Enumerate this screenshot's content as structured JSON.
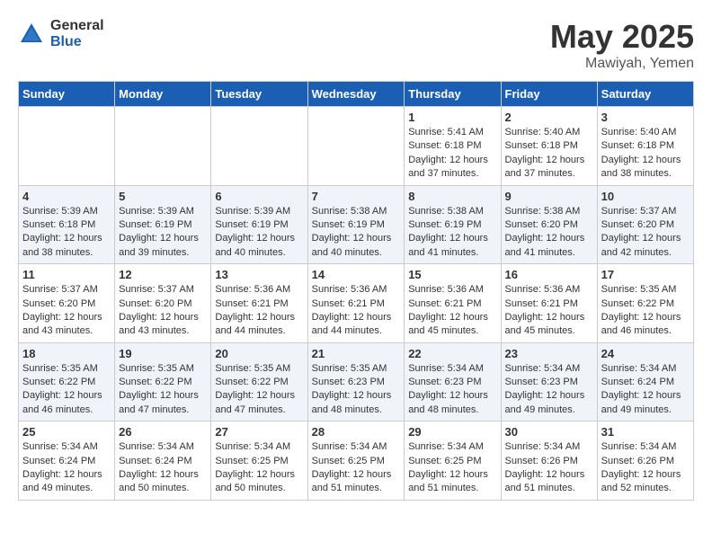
{
  "header": {
    "logo_general": "General",
    "logo_blue": "Blue",
    "month": "May 2025",
    "location": "Mawiyah, Yemen"
  },
  "days_of_week": [
    "Sunday",
    "Monday",
    "Tuesday",
    "Wednesday",
    "Thursday",
    "Friday",
    "Saturday"
  ],
  "weeks": [
    [
      {
        "day": "",
        "info": ""
      },
      {
        "day": "",
        "info": ""
      },
      {
        "day": "",
        "info": ""
      },
      {
        "day": "",
        "info": ""
      },
      {
        "day": "1",
        "info": "Sunrise: 5:41 AM\nSunset: 6:18 PM\nDaylight: 12 hours and 37 minutes."
      },
      {
        "day": "2",
        "info": "Sunrise: 5:40 AM\nSunset: 6:18 PM\nDaylight: 12 hours and 37 minutes."
      },
      {
        "day": "3",
        "info": "Sunrise: 5:40 AM\nSunset: 6:18 PM\nDaylight: 12 hours and 38 minutes."
      }
    ],
    [
      {
        "day": "4",
        "info": "Sunrise: 5:39 AM\nSunset: 6:18 PM\nDaylight: 12 hours and 38 minutes."
      },
      {
        "day": "5",
        "info": "Sunrise: 5:39 AM\nSunset: 6:19 PM\nDaylight: 12 hours and 39 minutes."
      },
      {
        "day": "6",
        "info": "Sunrise: 5:39 AM\nSunset: 6:19 PM\nDaylight: 12 hours and 40 minutes."
      },
      {
        "day": "7",
        "info": "Sunrise: 5:38 AM\nSunset: 6:19 PM\nDaylight: 12 hours and 40 minutes."
      },
      {
        "day": "8",
        "info": "Sunrise: 5:38 AM\nSunset: 6:19 PM\nDaylight: 12 hours and 41 minutes."
      },
      {
        "day": "9",
        "info": "Sunrise: 5:38 AM\nSunset: 6:20 PM\nDaylight: 12 hours and 41 minutes."
      },
      {
        "day": "10",
        "info": "Sunrise: 5:37 AM\nSunset: 6:20 PM\nDaylight: 12 hours and 42 minutes."
      }
    ],
    [
      {
        "day": "11",
        "info": "Sunrise: 5:37 AM\nSunset: 6:20 PM\nDaylight: 12 hours and 43 minutes."
      },
      {
        "day": "12",
        "info": "Sunrise: 5:37 AM\nSunset: 6:20 PM\nDaylight: 12 hours and 43 minutes."
      },
      {
        "day": "13",
        "info": "Sunrise: 5:36 AM\nSunset: 6:21 PM\nDaylight: 12 hours and 44 minutes."
      },
      {
        "day": "14",
        "info": "Sunrise: 5:36 AM\nSunset: 6:21 PM\nDaylight: 12 hours and 44 minutes."
      },
      {
        "day": "15",
        "info": "Sunrise: 5:36 AM\nSunset: 6:21 PM\nDaylight: 12 hours and 45 minutes."
      },
      {
        "day": "16",
        "info": "Sunrise: 5:36 AM\nSunset: 6:21 PM\nDaylight: 12 hours and 45 minutes."
      },
      {
        "day": "17",
        "info": "Sunrise: 5:35 AM\nSunset: 6:22 PM\nDaylight: 12 hours and 46 minutes."
      }
    ],
    [
      {
        "day": "18",
        "info": "Sunrise: 5:35 AM\nSunset: 6:22 PM\nDaylight: 12 hours and 46 minutes."
      },
      {
        "day": "19",
        "info": "Sunrise: 5:35 AM\nSunset: 6:22 PM\nDaylight: 12 hours and 47 minutes."
      },
      {
        "day": "20",
        "info": "Sunrise: 5:35 AM\nSunset: 6:22 PM\nDaylight: 12 hours and 47 minutes."
      },
      {
        "day": "21",
        "info": "Sunrise: 5:35 AM\nSunset: 6:23 PM\nDaylight: 12 hours and 48 minutes."
      },
      {
        "day": "22",
        "info": "Sunrise: 5:34 AM\nSunset: 6:23 PM\nDaylight: 12 hours and 48 minutes."
      },
      {
        "day": "23",
        "info": "Sunrise: 5:34 AM\nSunset: 6:23 PM\nDaylight: 12 hours and 49 minutes."
      },
      {
        "day": "24",
        "info": "Sunrise: 5:34 AM\nSunset: 6:24 PM\nDaylight: 12 hours and 49 minutes."
      }
    ],
    [
      {
        "day": "25",
        "info": "Sunrise: 5:34 AM\nSunset: 6:24 PM\nDaylight: 12 hours and 49 minutes."
      },
      {
        "day": "26",
        "info": "Sunrise: 5:34 AM\nSunset: 6:24 PM\nDaylight: 12 hours and 50 minutes."
      },
      {
        "day": "27",
        "info": "Sunrise: 5:34 AM\nSunset: 6:25 PM\nDaylight: 12 hours and 50 minutes."
      },
      {
        "day": "28",
        "info": "Sunrise: 5:34 AM\nSunset: 6:25 PM\nDaylight: 12 hours and 51 minutes."
      },
      {
        "day": "29",
        "info": "Sunrise: 5:34 AM\nSunset: 6:25 PM\nDaylight: 12 hours and 51 minutes."
      },
      {
        "day": "30",
        "info": "Sunrise: 5:34 AM\nSunset: 6:26 PM\nDaylight: 12 hours and 51 minutes."
      },
      {
        "day": "31",
        "info": "Sunrise: 5:34 AM\nSunset: 6:26 PM\nDaylight: 12 hours and 52 minutes."
      }
    ]
  ]
}
